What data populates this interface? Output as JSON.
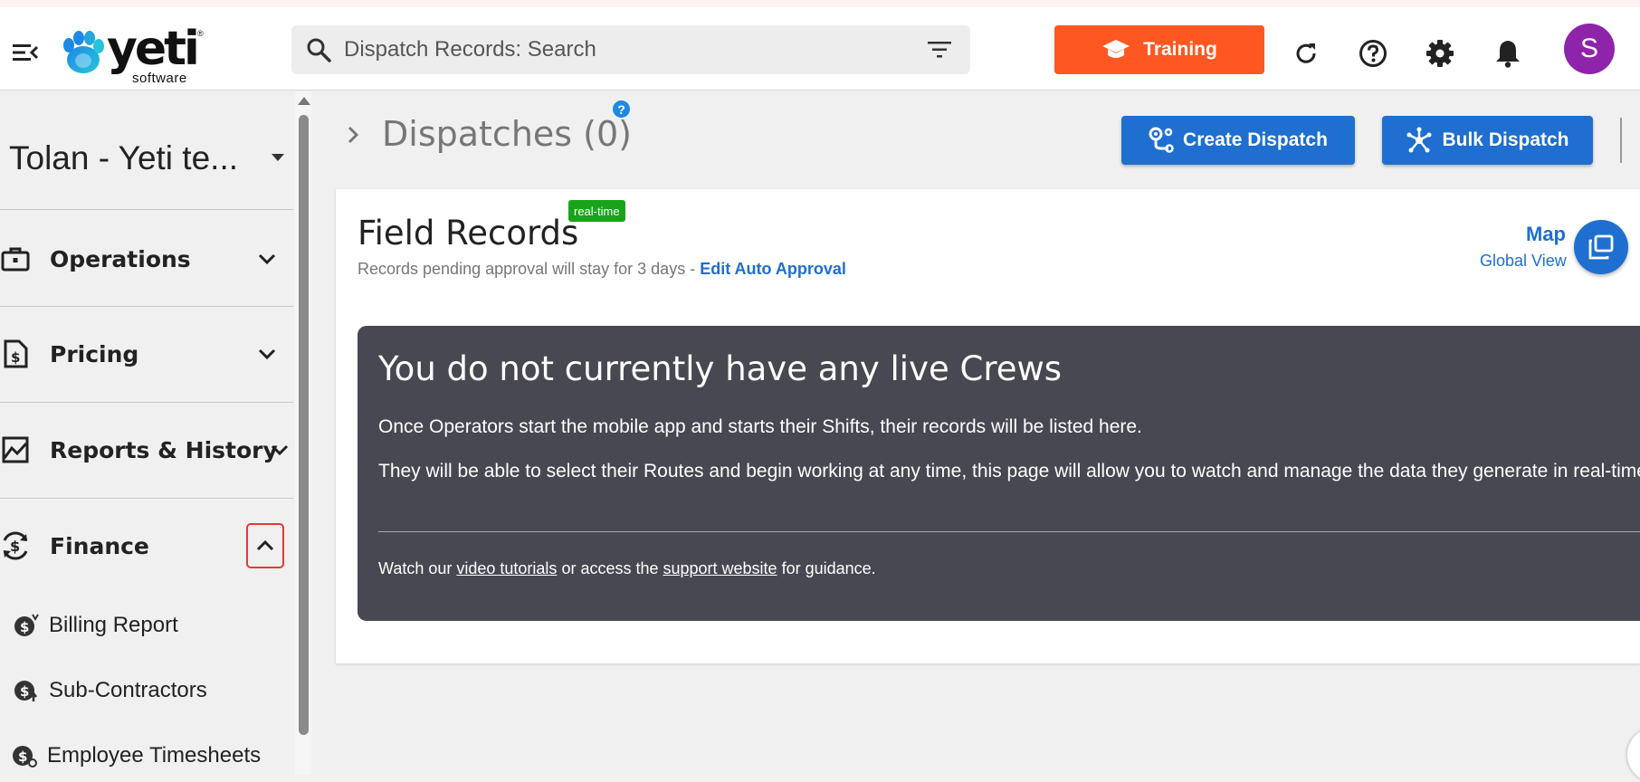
{
  "header": {
    "brand_word": "yeti",
    "brand_sub": "software",
    "brand_reg": "®",
    "search_placeholder": "Dispatch Records: Search",
    "training_label": "Training",
    "avatar_initial": "S"
  },
  "sidebar": {
    "org_name": "Tolan - Yeti te...",
    "nav": [
      {
        "label": "Operations",
        "icon": "briefcase-icon",
        "expanded": false
      },
      {
        "label": "Pricing",
        "icon": "invoice-icon",
        "expanded": false
      },
      {
        "label": "Reports & History",
        "icon": "chart-icon",
        "expanded": false
      },
      {
        "label": "Finance",
        "icon": "money-cycle-icon",
        "expanded": true
      }
    ],
    "finance_items": [
      {
        "label": "Billing Report",
        "icon": "dollar-icon"
      },
      {
        "label": "Sub-Contractors",
        "icon": "dollar-up-icon"
      },
      {
        "label": "Employee Timesheets",
        "icon": "dollar-time-icon"
      }
    ]
  },
  "main": {
    "dispatches_title": "Dispatches (0)",
    "help_mark": "?",
    "create_dispatch_label": "Create Dispatch",
    "bulk_dispatch_label": "Bulk Dispatch",
    "field_records_title": "Field Records",
    "realtime_badge": "real-time",
    "pending_text": "Records pending approval will stay for 3 days - ",
    "edit_auto_approval": "Edit Auto Approval",
    "map_label": "Map",
    "global_view_label": "Global View",
    "empty": {
      "title": "You do not currently have any live Crews",
      "p1": "Once Operators start the mobile app and starts their Shifts, their records will be listed here.",
      "p2": "They will be able to select their Routes and begin working at any time, this page will allow you to watch and manage the data they generate in real-time.",
      "foot_pre": "Watch our ",
      "video_link": "video tutorials",
      "foot_mid": " or access the ",
      "support_link": "support website",
      "foot_post": " for guidance."
    }
  },
  "colors": {
    "training": "#ff5722",
    "primary": "#1e6fd0",
    "avatar": "#8e24aa",
    "realtime": "#1aa31a",
    "empty_bg": "#484852"
  }
}
